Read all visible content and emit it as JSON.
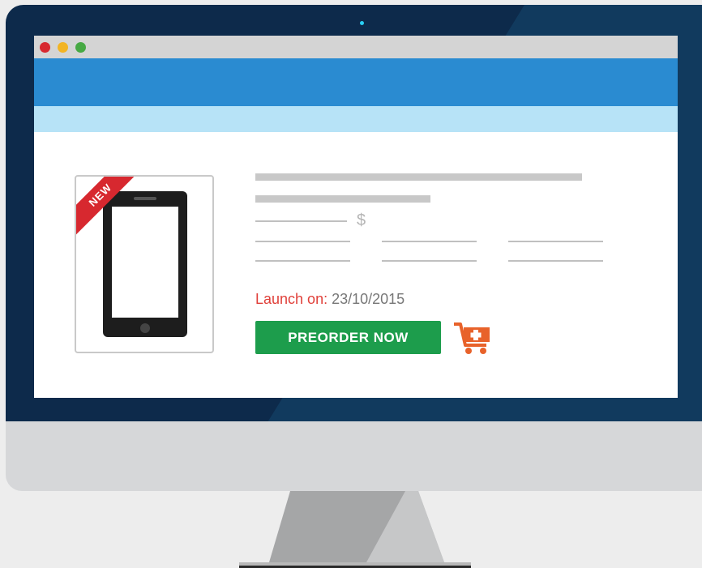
{
  "product": {
    "badge": "NEW",
    "price_symbol": "$",
    "launch_label": "Launch on:",
    "launch_date": "23/10/2015",
    "preorder_label": "PREORDER NOW",
    "cart_icon": "add-to-cart-icon"
  },
  "window_controls": [
    "close",
    "minimize",
    "maximize"
  ],
  "colors": {
    "bezel": "#0d2a4b",
    "nav": "#2a8bd1",
    "subnav": "#b7e3f7",
    "preorder": "#1d9d4c",
    "launch_label": "#e0403a",
    "cart": "#e8622a",
    "ribbon": "#d7282f"
  }
}
